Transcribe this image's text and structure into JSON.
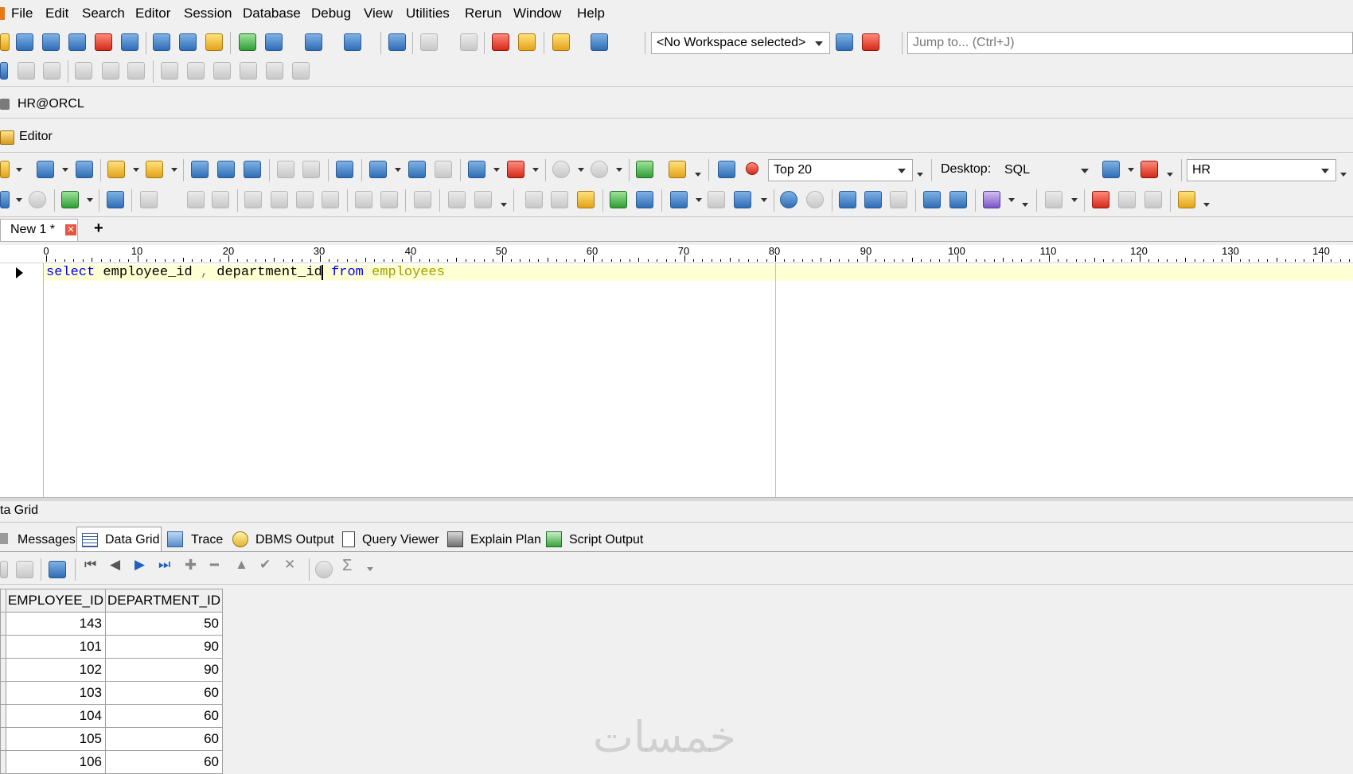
{
  "menu": [
    "File",
    "Edit",
    "Search",
    "Editor",
    "Session",
    "Database",
    "Debug",
    "View",
    "Utilities",
    "Rerun",
    "Window",
    "Help"
  ],
  "workspace": {
    "value": "<No Workspace selected>"
  },
  "jump": {
    "placeholder": "Jump to... (Ctrl+J)"
  },
  "connection_tab": "HR@ORCL",
  "editor_tab": "Editor",
  "editor_toolbar": {
    "top_rows_value": "Top 20",
    "desktop_label": "Desktop:",
    "desktop_value": "SQL",
    "schema_value": "HR"
  },
  "doc_tab": {
    "label": "New 1 *",
    "add": "+"
  },
  "ruler": [
    "0",
    "10",
    "20",
    "30",
    "40",
    "50",
    "60",
    "70",
    "80",
    "90",
    "100",
    "110",
    "120",
    "130",
    "140"
  ],
  "code": {
    "kw_select": "select",
    "col1": "employee_id",
    "comma": ",",
    "col2": "department_id",
    "kw_from": "from",
    "table": "employees"
  },
  "results": {
    "title": "ta Grid",
    "tabs": [
      "Messages",
      "Data Grid",
      "Trace",
      "DBMS Output",
      "Query Viewer",
      "Explain Plan",
      "Script Output"
    ],
    "columns": [
      "EMPLOYEE_ID",
      "DEPARTMENT_ID"
    ],
    "rows": [
      [
        "143",
        "50"
      ],
      [
        "101",
        "90"
      ],
      [
        "102",
        "90"
      ],
      [
        "103",
        "60"
      ],
      [
        "104",
        "60"
      ],
      [
        "105",
        "60"
      ],
      [
        "106",
        "60"
      ]
    ]
  },
  "watermark": "خمسات"
}
